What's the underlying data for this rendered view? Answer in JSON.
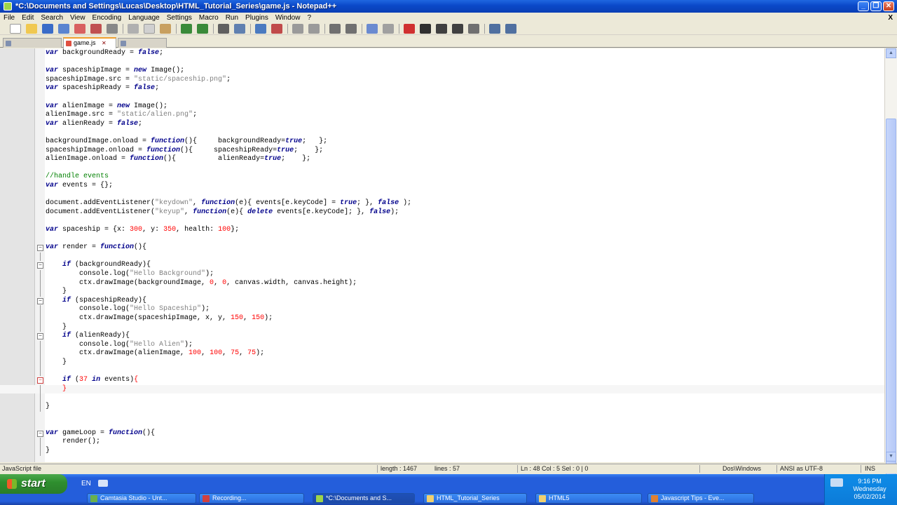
{
  "window": {
    "title": "*C:\\Documents and Settings\\Lucas\\Desktop\\HTML_Tutorial_Series\\game.js - Notepad++",
    "minimize": "_",
    "maximize": "❐",
    "close": "✕"
  },
  "menu": [
    "File",
    "Edit",
    "Search",
    "View",
    "Encoding",
    "Language",
    "Settings",
    "Macro",
    "Run",
    "Plugins",
    "Window",
    "?"
  ],
  "menu_close": "X",
  "tabs": [
    {
      "label": "",
      "active": false
    },
    {
      "label": "game.js",
      "active": true
    },
    {
      "label": "",
      "active": false
    }
  ],
  "editor": {
    "current_line": 48,
    "lines": [
      {
        "n": "",
        "fold": "",
        "segs": [
          [
            "kw",
            "var"
          ],
          [
            "t",
            " backgroundReady = "
          ],
          [
            "kw",
            "false"
          ],
          [
            "t",
            ";"
          ]
        ]
      },
      {
        "n": "",
        "fold": "",
        "segs": []
      },
      {
        "n": "",
        "fold": "",
        "segs": [
          [
            "kw",
            "var"
          ],
          [
            "t",
            " spaceshipImage = "
          ],
          [
            "kw",
            "new"
          ],
          [
            "t",
            " Image();"
          ]
        ]
      },
      {
        "n": "",
        "fold": "",
        "segs": [
          [
            "t",
            "spaceshipImage.src = "
          ],
          [
            "str",
            "\"static/spaceship.png\""
          ],
          [
            "t",
            ";"
          ]
        ]
      },
      {
        "n": "",
        "fold": "",
        "segs": [
          [
            "kw",
            "var"
          ],
          [
            "t",
            " spaceshipReady = "
          ],
          [
            "kw",
            "false"
          ],
          [
            "t",
            ";"
          ]
        ]
      },
      {
        "n": "",
        "fold": "",
        "segs": []
      },
      {
        "n": "",
        "fold": "",
        "segs": [
          [
            "kw",
            "var"
          ],
          [
            "t",
            " alienImage = "
          ],
          [
            "kw",
            "new"
          ],
          [
            "t",
            " Image();"
          ]
        ]
      },
      {
        "n": "",
        "fold": "",
        "segs": [
          [
            "t",
            "alienImage.src = "
          ],
          [
            "str",
            "\"static/alien.png\""
          ],
          [
            "t",
            ";"
          ]
        ]
      },
      {
        "n": "",
        "fold": "",
        "segs": [
          [
            "kw",
            "var"
          ],
          [
            "t",
            " alienReady = "
          ],
          [
            "kw",
            "false"
          ],
          [
            "t",
            ";"
          ]
        ]
      },
      {
        "n": "",
        "fold": "",
        "segs": []
      },
      {
        "n": "",
        "fold": "",
        "segs": [
          [
            "t",
            "backgroundImage.onload = "
          ],
          [
            "kw",
            "function"
          ],
          [
            "t",
            "(){     backgroundReady="
          ],
          [
            "kw",
            "true"
          ],
          [
            "t",
            ";   };"
          ]
        ]
      },
      {
        "n": "",
        "fold": "",
        "segs": [
          [
            "t",
            "spaceshipImage.onload = "
          ],
          [
            "kw",
            "function"
          ],
          [
            "t",
            "(){     spaceshipReady="
          ],
          [
            "kw",
            "true"
          ],
          [
            "t",
            ";    };"
          ]
        ]
      },
      {
        "n": "",
        "fold": "",
        "segs": [
          [
            "t",
            "alienImage.onload = "
          ],
          [
            "kw",
            "function"
          ],
          [
            "t",
            "(){          alienReady="
          ],
          [
            "kw",
            "true"
          ],
          [
            "t",
            ";    };"
          ]
        ]
      },
      {
        "n": "",
        "fold": "",
        "segs": []
      },
      {
        "n": "",
        "fold": "",
        "segs": [
          [
            "cmt",
            "//handle events"
          ]
        ]
      },
      {
        "n": "",
        "fold": "",
        "segs": [
          [
            "kw",
            "var"
          ],
          [
            "t",
            " events = {};"
          ]
        ]
      },
      {
        "n": "",
        "fold": "",
        "segs": []
      },
      {
        "n": "",
        "fold": "",
        "segs": [
          [
            "t",
            "document.addEventListener("
          ],
          [
            "str",
            "\"keydown\""
          ],
          [
            "t",
            ", "
          ],
          [
            "kw",
            "function"
          ],
          [
            "t",
            "(e){ events[e.keyCode] = "
          ],
          [
            "kw",
            "true"
          ],
          [
            "t",
            "; }, "
          ],
          [
            "kw",
            "false"
          ],
          [
            "t",
            " );"
          ]
        ]
      },
      {
        "n": "",
        "fold": "",
        "segs": [
          [
            "t",
            "document.addEventListener("
          ],
          [
            "str",
            "\"keyup\""
          ],
          [
            "t",
            ", "
          ],
          [
            "kw",
            "function"
          ],
          [
            "t",
            "(e){ "
          ],
          [
            "kw",
            "delete"
          ],
          [
            "t",
            " events[e.keyCode]; }, "
          ],
          [
            "kw",
            "false"
          ],
          [
            "t",
            ");"
          ]
        ]
      },
      {
        "n": "",
        "fold": "",
        "segs": []
      },
      {
        "n": "",
        "fold": "",
        "segs": [
          [
            "kw",
            "var"
          ],
          [
            "t",
            " spaceship = {x: "
          ],
          [
            "num",
            "300"
          ],
          [
            "t",
            ", y: "
          ],
          [
            "num",
            "350"
          ],
          [
            "t",
            ", health: "
          ],
          [
            "num",
            "100"
          ],
          [
            "t",
            "};"
          ]
        ]
      },
      {
        "n": "",
        "fold": "",
        "segs": []
      },
      {
        "n": "",
        "fold": "box",
        "segs": [
          [
            "kw",
            "var"
          ],
          [
            "t",
            " render = "
          ],
          [
            "kw",
            "function"
          ],
          [
            "t",
            "(){"
          ]
        ]
      },
      {
        "n": "",
        "fold": "guide",
        "segs": []
      },
      {
        "n": "",
        "fold": "box",
        "segs": [
          [
            "t",
            "    "
          ],
          [
            "kw",
            "if"
          ],
          [
            "t",
            " (backgroundReady){"
          ]
        ]
      },
      {
        "n": "",
        "fold": "guide",
        "segs": [
          [
            "t",
            "        console.log("
          ],
          [
            "str",
            "\"Hello Background\""
          ],
          [
            "t",
            ");"
          ]
        ]
      },
      {
        "n": "",
        "fold": "guide",
        "segs": [
          [
            "t",
            "        ctx.drawImage(backgroundImage, "
          ],
          [
            "num",
            "0"
          ],
          [
            "t",
            ", "
          ],
          [
            "num",
            "0"
          ],
          [
            "t",
            ", canvas.width, canvas.height);"
          ]
        ]
      },
      {
        "n": "",
        "fold": "guide",
        "segs": [
          [
            "t",
            "    }"
          ]
        ]
      },
      {
        "n": "",
        "fold": "box",
        "segs": [
          [
            "t",
            "    "
          ],
          [
            "kw",
            "if"
          ],
          [
            "t",
            " (spaceshipReady){"
          ]
        ]
      },
      {
        "n": "",
        "fold": "guide",
        "segs": [
          [
            "t",
            "        console.log("
          ],
          [
            "str",
            "\"Hello Spaceship\""
          ],
          [
            "t",
            ");"
          ]
        ]
      },
      {
        "n": "",
        "fold": "guide",
        "segs": [
          [
            "t",
            "        ctx.drawImage(spaceshipImage, x, y, "
          ],
          [
            "num",
            "150"
          ],
          [
            "t",
            ", "
          ],
          [
            "num",
            "150"
          ],
          [
            "t",
            ");"
          ]
        ]
      },
      {
        "n": "",
        "fold": "guide",
        "segs": [
          [
            "t",
            "    }"
          ]
        ]
      },
      {
        "n": "",
        "fold": "box",
        "segs": [
          [
            "t",
            "    "
          ],
          [
            "kw",
            "if"
          ],
          [
            "t",
            " (alienReady){"
          ]
        ]
      },
      {
        "n": "",
        "fold": "guide",
        "segs": [
          [
            "t",
            "        console.log("
          ],
          [
            "str",
            "\"Hello Alien\""
          ],
          [
            "t",
            ");"
          ]
        ]
      },
      {
        "n": "",
        "fold": "guide",
        "segs": [
          [
            "t",
            "        ctx.drawImage(alienImage, "
          ],
          [
            "num",
            "100"
          ],
          [
            "t",
            ", "
          ],
          [
            "num",
            "100"
          ],
          [
            "t",
            ", "
          ],
          [
            "num",
            "75"
          ],
          [
            "t",
            ", "
          ],
          [
            "num",
            "75"
          ],
          [
            "t",
            ");"
          ]
        ]
      },
      {
        "n": "",
        "fold": "guide",
        "segs": [
          [
            "t",
            "    }"
          ]
        ]
      },
      {
        "n": "",
        "fold": "guide",
        "segs": []
      },
      {
        "n": "",
        "fold": "redbox",
        "segs": [
          [
            "t",
            "    "
          ],
          [
            "kw",
            "if"
          ],
          [
            "t",
            " ("
          ],
          [
            "num",
            "37"
          ],
          [
            "t",
            " "
          ],
          [
            "kw",
            "in"
          ],
          [
            "t",
            " events)"
          ],
          [
            "red",
            "{"
          ]
        ]
      },
      {
        "n": "",
        "fold": "guide",
        "segs": [
          [
            "t",
            "    "
          ],
          [
            "red",
            "}"
          ]
        ],
        "current": true
      },
      {
        "n": "",
        "fold": "guide",
        "segs": []
      },
      {
        "n": "",
        "fold": "guide",
        "segs": [
          [
            "t",
            "}"
          ]
        ]
      },
      {
        "n": "",
        "fold": "",
        "segs": []
      },
      {
        "n": "",
        "fold": "",
        "segs": []
      },
      {
        "n": "",
        "fold": "box",
        "segs": [
          [
            "kw",
            "var"
          ],
          [
            "t",
            " gameLoop = "
          ],
          [
            "kw",
            "function"
          ],
          [
            "t",
            "(){"
          ]
        ]
      },
      {
        "n": "",
        "fold": "guide",
        "segs": [
          [
            "t",
            "    render();"
          ]
        ]
      },
      {
        "n": "",
        "fold": "guide",
        "segs": [
          [
            "t",
            "}"
          ]
        ]
      }
    ]
  },
  "status": {
    "file_type": "JavaScript file",
    "length": "length : 1467",
    "lines": "lines : 57",
    "position": "Ln : 48    Col : 5    Sel : 0 | 0",
    "eol": "Dos\\Windows",
    "encoding": "ANSI as UTF-8",
    "mode": "INS"
  },
  "taskbar": {
    "start_label": "start",
    "language": "EN",
    "tasks": [
      {
        "label": "Camtasia Studio - Unt...",
        "active": false
      },
      {
        "label": "Recording...",
        "active": false
      },
      {
        "label": "*C:\\Documents and S...",
        "active": true
      },
      {
        "label": "HTML_Tutorial_Series",
        "active": false
      },
      {
        "label": "HTML5",
        "active": false
      },
      {
        "label": "Javascript Tips - Eve...",
        "active": false
      }
    ],
    "clock": {
      "time": "9:16 PM",
      "day": "Wednesday",
      "date": "05/02/2014"
    }
  },
  "colors": {
    "keyword": "#00008b",
    "string": "#808080",
    "number": "#ff0000",
    "comment": "#008000",
    "titlebar": "#0a48c8",
    "taskbar": "#245edb",
    "start": "#2f8f2f"
  }
}
